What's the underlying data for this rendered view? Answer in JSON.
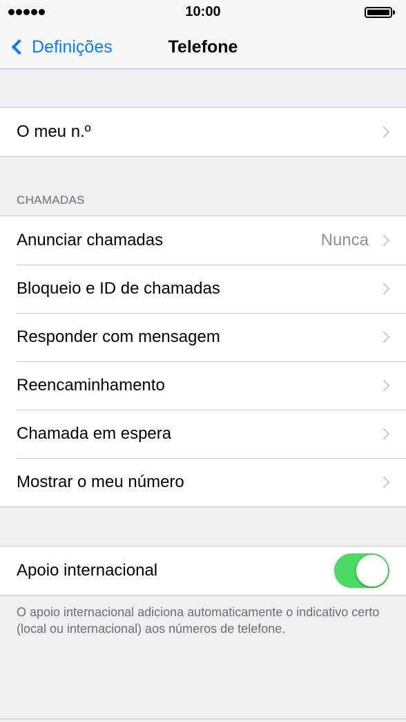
{
  "status_bar": {
    "time": "10:00",
    "signal_icon": "signal-dots-icon",
    "battery_icon": "battery-full-icon"
  },
  "nav": {
    "back_label": "Definições",
    "back_icon": "chevron-left-icon",
    "title": "Telefone",
    "accent_color": "#0a7aff"
  },
  "my_number": {
    "label": "O meu n.º"
  },
  "calls_section": {
    "header": "CHAMADAS",
    "items": [
      {
        "label": "Anunciar chamadas",
        "value": "Nunca"
      },
      {
        "label": "Bloqueio e ID de chamadas"
      },
      {
        "label": "Responder com mensagem"
      },
      {
        "label": "Reencaminhamento"
      },
      {
        "label": "Chamada em espera"
      },
      {
        "label": "Mostrar o meu número"
      }
    ]
  },
  "international": {
    "label": "Apoio internacional",
    "enabled": true,
    "toggle_color": "#4cd964",
    "footer": "O apoio internacional adiciona automaticamente o indicativo certo (local ou internacional) aos números de telefone."
  }
}
